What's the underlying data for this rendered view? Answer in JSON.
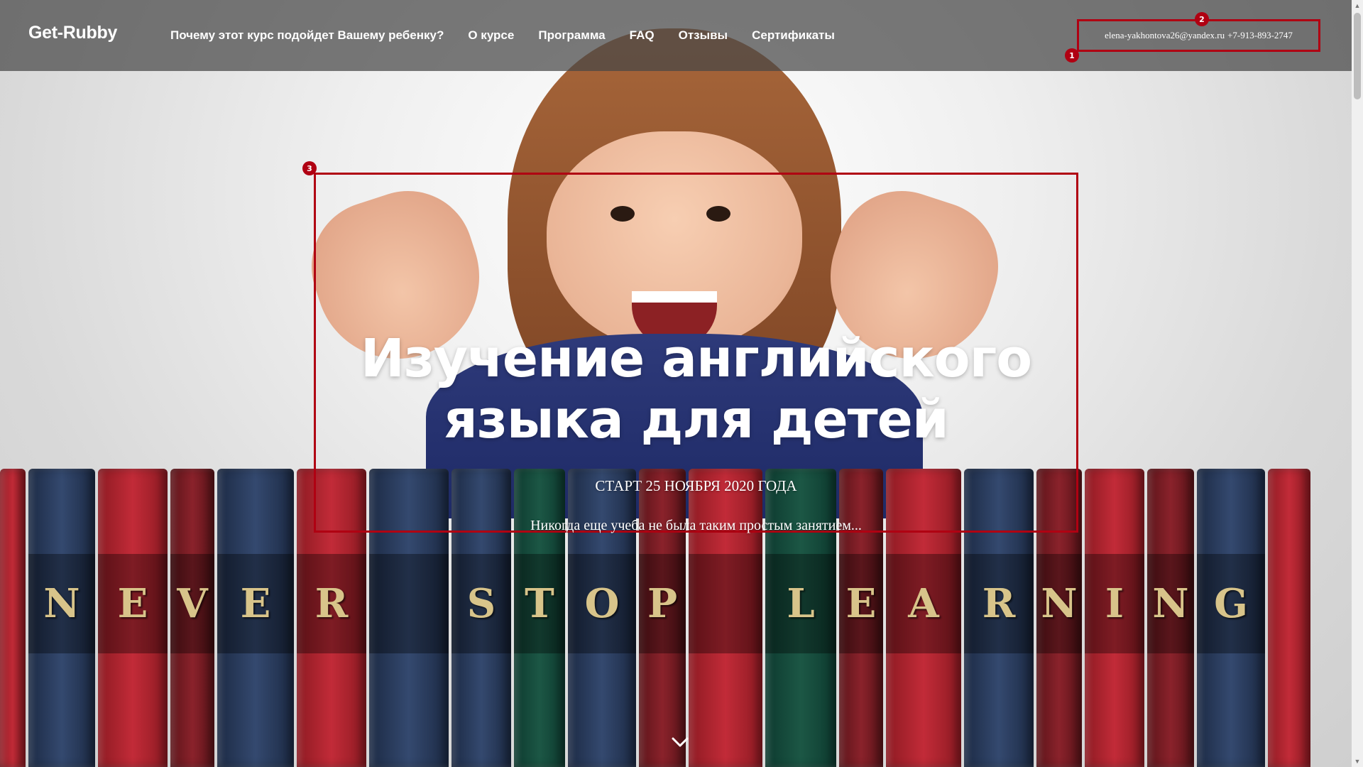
{
  "header": {
    "logo": "Get-Rubby",
    "nav": [
      "Почему этот курс подойдет Вашему ребенку?",
      "О курсе",
      "Программа",
      "FAQ",
      "Отзывы",
      "Сертификаты"
    ],
    "contact": {
      "email": "elena-yakhontova26@yandex.ru",
      "phone": "+7-913-893-2747"
    }
  },
  "hero": {
    "title_line1": "Изучение английского",
    "title_line2": "языка для детей",
    "date": "СТАРТ 25 НОЯБРЯ 2020 ГОДА",
    "tagline": "Никогда еще учеба не была таким простым занятием..."
  },
  "books_text": [
    "N",
    "E",
    "V",
    "E",
    "R",
    "",
    "S",
    "T",
    "O",
    "P",
    "",
    "L",
    "E",
    "A",
    "R",
    "N",
    "I",
    "N",
    "G"
  ],
  "markers": [
    "1",
    "2",
    "3"
  ],
  "icons": {
    "scroll_down": "chevron-down-icon"
  },
  "colors": {
    "accent_red": "#b00012",
    "header_bg": "rgba(70,70,70,0.72)"
  }
}
